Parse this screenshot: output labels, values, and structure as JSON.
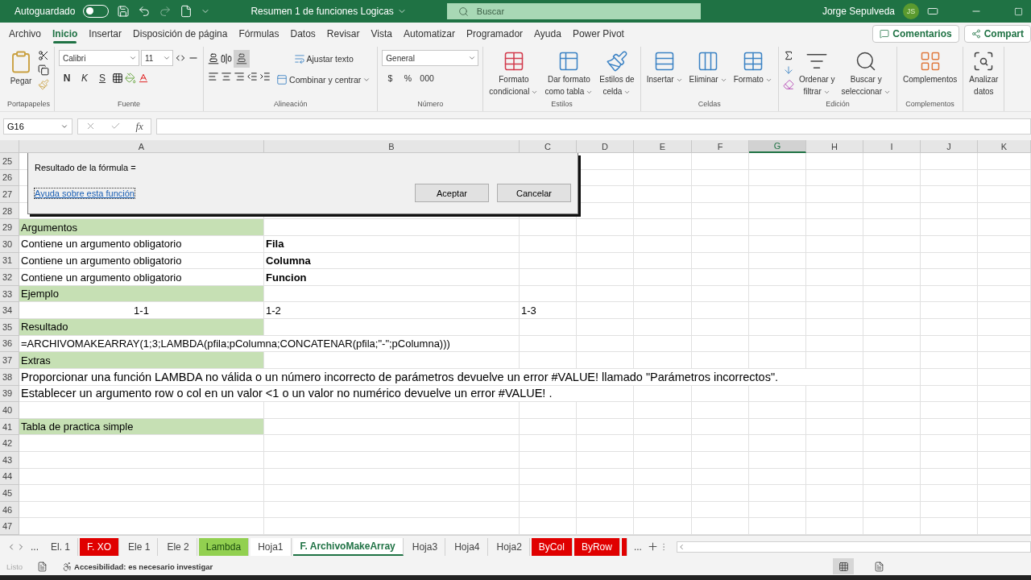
{
  "title_bar": {
    "autosave_label": "Autoguardado",
    "autosave_on": false,
    "document_title": "Resumen 1 de funciones Logicas",
    "search_placeholder": "Buscar",
    "user_name": "Jorge Sepulveda",
    "user_initials": "JS"
  },
  "menu_tabs": [
    {
      "label": "Archivo",
      "selected": false
    },
    {
      "label": "Inicio",
      "selected": true
    },
    {
      "label": "Insertar",
      "selected": false
    },
    {
      "label": "Disposición de página",
      "selected": false
    },
    {
      "label": "Fórmulas",
      "selected": false
    },
    {
      "label": "Datos",
      "selected": false
    },
    {
      "label": "Revisar",
      "selected": false
    },
    {
      "label": "Vista",
      "selected": false
    },
    {
      "label": "Automatizar",
      "selected": false
    },
    {
      "label": "Programador",
      "selected": false
    },
    {
      "label": "Ayuda",
      "selected": false
    },
    {
      "label": "Power Pivot",
      "selected": false
    }
  ],
  "comments_button": "Comentarios",
  "share_button": "Compart",
  "ribbon": [
    {
      "label": "Portapapeles",
      "kind": "clipboard",
      "paste": "Pegar"
    },
    {
      "label": "Fuente",
      "kind": "font",
      "font_name": "Calibri",
      "font_size": "11",
      "bold": "N",
      "italic": "K",
      "underline": "S"
    },
    {
      "label": "Alineación",
      "kind": "alignment",
      "wrap": "Ajustar texto",
      "merge": "Combinar y centrar"
    },
    {
      "label": "Número",
      "kind": "number",
      "format": "General",
      "currency": "$",
      "percent": "%",
      "thousands": "000"
    },
    {
      "label": "Estilos",
      "kind": "buttons",
      "items": [
        {
          "lines": [
            "Formato",
            "condicional"
          ]
        },
        {
          "lines": [
            "Dar formato",
            "como tabla"
          ]
        },
        {
          "lines": [
            "Estilos de",
            "celda"
          ]
        }
      ]
    },
    {
      "label": "Celdas",
      "kind": "buttons",
      "items": [
        {
          "lines": [
            "Insertar"
          ]
        },
        {
          "lines": [
            "Eliminar"
          ]
        },
        {
          "lines": [
            "Formato"
          ]
        }
      ]
    },
    {
      "label": "Edición",
      "kind": "editing",
      "items": [
        {
          "lines": [
            "Ordenar y",
            "filtrar"
          ]
        },
        {
          "lines": [
            "Buscar y",
            "seleccionar"
          ]
        }
      ]
    },
    {
      "label": "Complementos",
      "kind": "buttons",
      "items": [
        {
          "lines": [
            "Complementos"
          ]
        }
      ]
    },
    {
      "kind": "buttons",
      "items": [
        {
          "lines": [
            "Analizar",
            "datos"
          ]
        }
      ]
    }
  ],
  "formula_bar": {
    "name_box": "G16",
    "insert_function": "fx"
  },
  "columns": [
    {
      "label": "A",
      "selected": false
    },
    {
      "label": "B",
      "selected": false
    },
    {
      "label": "C",
      "selected": false
    },
    {
      "label": "D",
      "selected": false
    },
    {
      "label": "E",
      "selected": false
    },
    {
      "label": "F",
      "selected": false
    },
    {
      "label": "G",
      "selected": true
    },
    {
      "label": "H",
      "selected": false
    },
    {
      "label": "I",
      "selected": false
    },
    {
      "label": "J",
      "selected": false
    },
    {
      "label": "K",
      "selected": false
    }
  ],
  "rows": [
    {
      "number": "25",
      "cells": {}
    },
    {
      "number": "26",
      "cells": {}
    },
    {
      "number": "27",
      "cells": {}
    },
    {
      "number": "28",
      "cells": {}
    },
    {
      "number": "29",
      "cells": {
        "A": {
          "text": "Argumentos",
          "kind": "plain",
          "highlighted": true
        }
      }
    },
    {
      "number": "30",
      "cells": {
        "A": {
          "text": "Contiene un argumento obligatorio",
          "kind": "plain",
          "highlighted": false
        },
        "B": {
          "text": "Fila",
          "kind": "bold",
          "highlighted": false
        }
      }
    },
    {
      "number": "31",
      "cells": {
        "A": {
          "text": "Contiene un argumento obligatorio",
          "kind": "plain",
          "highlighted": false
        },
        "B": {
          "text": "Columna",
          "kind": "bold",
          "highlighted": false
        }
      }
    },
    {
      "number": "32",
      "cells": {
        "A": {
          "text": "Contiene un argumento obligatorio",
          "kind": "plain",
          "highlighted": false
        },
        "B": {
          "text": "Funcion",
          "kind": "bold",
          "highlighted": false
        }
      }
    },
    {
      "number": "33",
      "cells": {
        "A": {
          "text": "Ejemplo",
          "kind": "plain",
          "highlighted": true
        }
      }
    },
    {
      "number": "34",
      "cells": {
        "A": {
          "text": "1-1",
          "kind": "center",
          "highlighted": false
        },
        "B": {
          "text": "1-2",
          "kind": "plain",
          "highlighted": false
        },
        "C": {
          "text": "1-3",
          "kind": "plain",
          "highlighted": false
        }
      }
    },
    {
      "number": "35",
      "cells": {
        "A": {
          "text": "Resultado",
          "kind": "plain",
          "highlighted": true
        }
      }
    },
    {
      "number": "36",
      "cells": {
        "A": {
          "text": "=ARCHIVOMAKEARRAY(1;3;LAMBDA(pfila;pColumna;CONCATENAR(pfila;\"-\";pColumna)))",
          "kind": "plain",
          "highlighted": false
        }
      }
    },
    {
      "number": "37",
      "cells": {
        "A": {
          "text": "Extras",
          "kind": "plain",
          "highlighted": true
        }
      }
    },
    {
      "number": "38",
      "cells": {
        "A": {
          "text": "Proporcionar una función LAMBDA no válida o un número incorrecto de parámetros devuelve un error #VALUE! llamado \"Parámetros incorrectos\".",
          "kind": "large",
          "highlighted": false
        }
      }
    },
    {
      "number": "39",
      "cells": {
        "A": {
          "text": "Establecer un argumento row o col en un valor <1 o un valor no numérico devuelve un error #VALUE! .",
          "kind": "large",
          "highlighted": false
        }
      }
    },
    {
      "number": "40",
      "cells": {}
    },
    {
      "number": "41",
      "cells": {
        "A": {
          "text": "Tabla de practica simple",
          "kind": "plain",
          "highlighted": true
        }
      }
    },
    {
      "number": "42",
      "cells": {}
    },
    {
      "number": "43",
      "cells": {}
    },
    {
      "number": "44",
      "cells": {}
    },
    {
      "number": "45",
      "cells": {}
    },
    {
      "number": "46",
      "cells": {}
    },
    {
      "number": "47",
      "cells": {}
    }
  ],
  "dialog": {
    "result_label": "Resultado de la fórmula =",
    "help_link": "Ayuda sobre esta función",
    "buttons": [
      "Aceptar",
      "Cancelar"
    ]
  },
  "sheet_tabs": {
    "overflow_before": "...",
    "overflow_after": "...",
    "tabs": [
      {
        "label": "El. 1",
        "selected": false,
        "active": false
      },
      {
        "label": "F. XO",
        "selected": false,
        "active": false,
        "color": "#e00000"
      },
      {
        "label": "Ele 1",
        "selected": false,
        "active": false
      },
      {
        "label": "Ele 2",
        "selected": false,
        "active": false
      },
      {
        "label": "Lambda",
        "selected": false,
        "active": false,
        "color": "#92d050"
      },
      {
        "label": "Hoja1",
        "selected": true,
        "active": false
      },
      {
        "label": "F. ArchivoMakeArray",
        "selected": true,
        "active": true
      },
      {
        "label": "Hoja3",
        "selected": false,
        "active": false
      },
      {
        "label": "Hoja4",
        "selected": false,
        "active": false
      },
      {
        "label": "Hoja2",
        "selected": false,
        "active": false
      },
      {
        "label": "ByCol",
        "selected": false,
        "active": false,
        "color": "#e00000"
      },
      {
        "label": "ByRow",
        "selected": false,
        "active": false,
        "color": "#e00000"
      },
      {
        "selected": false,
        "active": false,
        "color": "#e00000"
      }
    ]
  },
  "status_bar": {
    "ready": "Listo",
    "accessibility": "Accesibilidad: es necesario investigar"
  }
}
